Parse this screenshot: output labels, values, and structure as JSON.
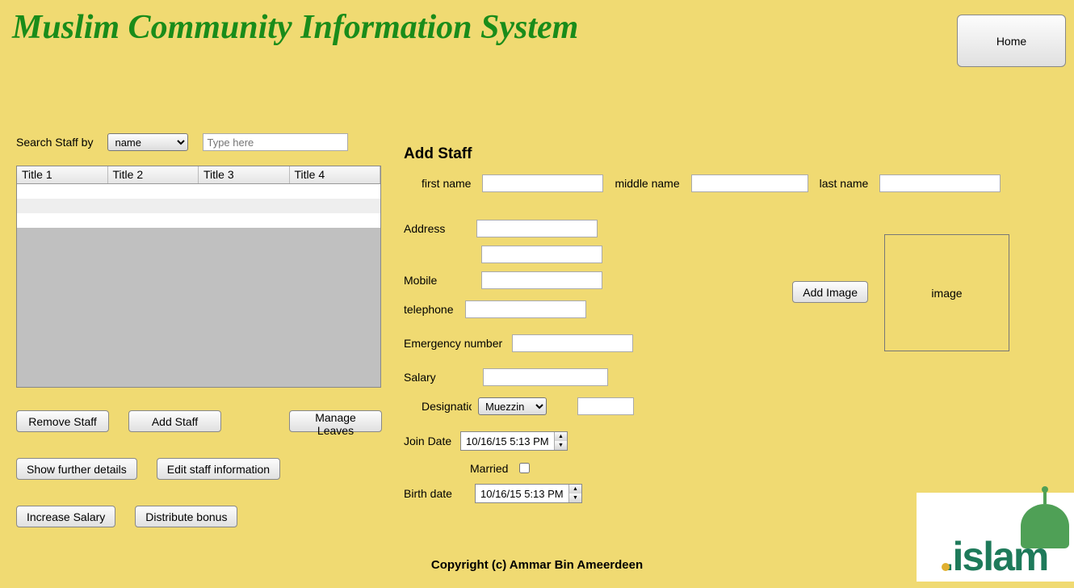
{
  "header": {
    "title": "Muslim Community Information System",
    "home_button": "Home"
  },
  "search": {
    "label": "Search Staff by",
    "by_options": [
      "name"
    ],
    "by_selected": "name",
    "placeholder": "Type here"
  },
  "table": {
    "columns": [
      "Title 1",
      "Title 2",
      "Title 3",
      "Title 4"
    ]
  },
  "actions": {
    "remove_staff": "Remove Staff",
    "add_staff": "Add Staff",
    "manage_leaves": "Manage Leaves",
    "show_details": "Show further details",
    "edit_staff": "Edit staff information",
    "increase_salary": "Increase Salary",
    "distribute_bonus": "Distribute bonus"
  },
  "add_staff": {
    "title": "Add Staff",
    "first_name_label": "first name",
    "middle_name_label": "middle name",
    "last_name_label": "last name",
    "address_label": "Address",
    "mobile_label": "Mobile",
    "telephone_label": "telephone",
    "emergency_label": "Emergency number",
    "salary_label": "Salary",
    "designation_label": "Designation",
    "designation_options": [
      "Muezzin"
    ],
    "designation_selected": "Muezzin",
    "join_date_label": "Join Date",
    "join_date_value": "10/16/15 5:13 PM",
    "married_label": "Married",
    "birth_date_label": "Birth date",
    "birth_date_value": "10/16/15 5:13 PM",
    "add_image_button": "Add Image",
    "image_placeholder": "image"
  },
  "footer": {
    "copyright": "Copyright (c) Ammar Bin Ameerdeen",
    "logo_text": "islam"
  }
}
